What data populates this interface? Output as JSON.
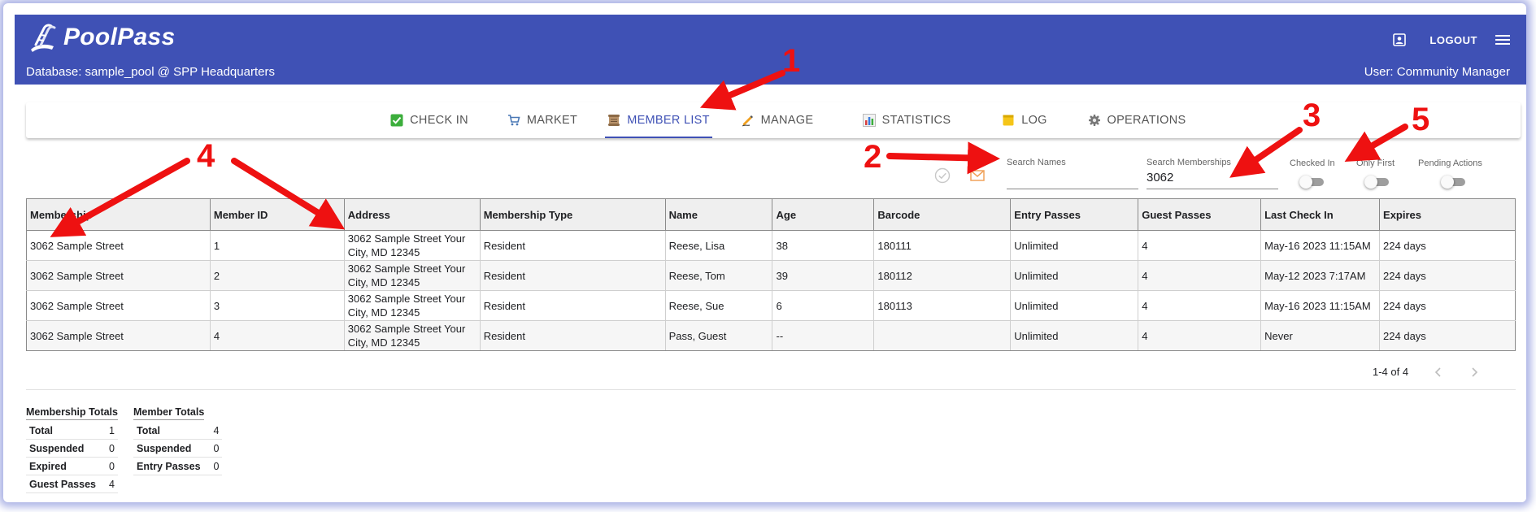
{
  "header": {
    "app_name": "PoolPass",
    "database_line": "Database: sample_pool @ SPP Headquarters",
    "user_line": "User: Community Manager",
    "logout_label": "LOGOUT"
  },
  "nav": {
    "tabs": [
      {
        "label": "CHECK IN",
        "icon": "check-box-icon"
      },
      {
        "label": "MARKET",
        "icon": "cart-icon"
      },
      {
        "label": "MEMBER LIST",
        "icon": "scroll-icon",
        "active": true
      },
      {
        "label": "MANAGE",
        "icon": "pencil-icon"
      },
      {
        "label": "STATISTICS",
        "icon": "bar-chart-icon"
      },
      {
        "label": "LOG",
        "icon": "notepad-icon"
      },
      {
        "label": "OPERATIONS",
        "icon": "gear-icon"
      }
    ]
  },
  "toolbar": {
    "search_names_label": "Search Names",
    "search_names_value": "",
    "search_memberships_label": "Search Memberships",
    "search_memberships_value": "3062",
    "toggles": [
      {
        "label": "Checked In",
        "on": false
      },
      {
        "label": "Only First",
        "on": false
      },
      {
        "label": "Pending Actions",
        "on": false
      }
    ]
  },
  "table": {
    "columns": [
      "Membership",
      "Member ID",
      "Address",
      "Membership Type",
      "Name",
      "Age",
      "Barcode",
      "Entry Passes",
      "Guest Passes",
      "Last Check In",
      "Expires"
    ],
    "rows": [
      [
        "3062 Sample Street",
        "1",
        "3062 Sample Street Your City, MD 12345",
        "Resident",
        "Reese, Lisa",
        "38",
        "180111",
        "Unlimited",
        "4",
        "May-16 2023 11:15AM",
        "224 days"
      ],
      [
        "3062 Sample Street",
        "2",
        "3062 Sample Street Your City, MD 12345",
        "Resident",
        "Reese, Tom",
        "39",
        "180112",
        "Unlimited",
        "4",
        "May-12 2023 7:17AM",
        "224 days"
      ],
      [
        "3062 Sample Street",
        "3",
        "3062 Sample Street Your City, MD 12345",
        "Resident",
        "Reese, Sue",
        "6",
        "180113",
        "Unlimited",
        "4",
        "May-16 2023 11:15AM",
        "224 days"
      ],
      [
        "3062 Sample Street",
        "4",
        "3062 Sample Street Your City, MD 12345",
        "Resident",
        "Pass, Guest",
        "--",
        "",
        "Unlimited",
        "4",
        "Never",
        "224 days"
      ]
    ]
  },
  "pagination": {
    "range": "1-4 of 4"
  },
  "membership_totals": {
    "title": "Membership Totals",
    "rows": [
      [
        "Total",
        "1"
      ],
      [
        "Suspended",
        "0"
      ],
      [
        "Expired",
        "0"
      ],
      [
        "Guest Passes",
        "4"
      ]
    ]
  },
  "member_totals": {
    "title": "Member Totals",
    "rows": [
      [
        "Total",
        "4"
      ],
      [
        "Suspended",
        "0"
      ],
      [
        "Entry Passes",
        "0"
      ]
    ]
  },
  "annotations": {
    "labels": [
      "1",
      "2",
      "3",
      "4",
      "5"
    ],
    "color": "#ee1111"
  },
  "colors": {
    "primary": "#3f51b5",
    "frame_glow": "#aeb5e6"
  }
}
